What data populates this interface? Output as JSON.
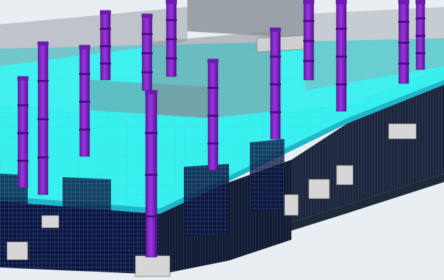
{
  "viewport": {
    "title": "",
    "background": "#e9eef2"
  },
  "scene": {
    "slab_color": "#37f0f0",
    "slab_edge_color": "#1fb8c8",
    "column_color": "#8f2bd6",
    "column_dark": "#5a1296",
    "wall_color": "#9aa3aa",
    "cage_color": "#1a2a55",
    "cage_line": "#4f6ad1",
    "footing_color": "#d6d6d6",
    "icons": [
      "column-icon",
      "slab-icon",
      "wall-icon",
      "cage-icon",
      "footing-icon"
    ]
  }
}
